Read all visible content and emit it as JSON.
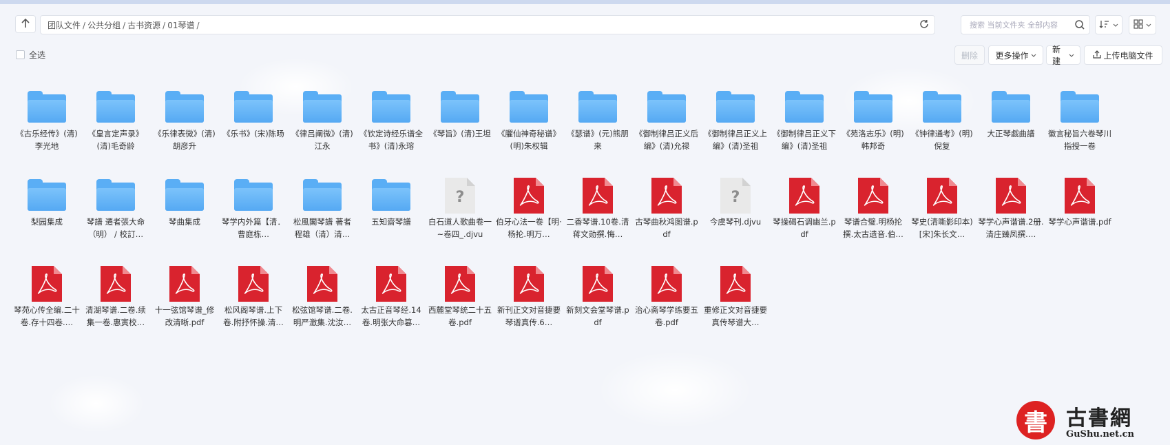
{
  "path": {
    "crumbs": [
      "团队文件",
      "公共分组",
      "古书资源",
      "01琴谱"
    ]
  },
  "search": {
    "placeholder": "搜索 当前文件夹 全部内容"
  },
  "toolbar": {
    "select_all": "全选",
    "delete": "删除",
    "more": "更多操作",
    "new": "新建",
    "upload": "上传电脑文件"
  },
  "colors": {
    "folder": "#5aaef5",
    "pdf": "#d9232e",
    "unknown": "#e9e9e9"
  },
  "files": [
    {
      "type": "folder",
      "name": "《古乐经传》(清)李光地"
    },
    {
      "type": "folder",
      "name": "《皇言定声录》(清)毛奇龄"
    },
    {
      "type": "folder",
      "name": "《乐律表微》(清)胡彦升"
    },
    {
      "type": "folder",
      "name": "《乐书》(宋)陈旸"
    },
    {
      "type": "folder",
      "name": "《律吕阐微》(清)江永"
    },
    {
      "type": "folder",
      "name": "《钦定诗经乐谱全书》(清)永瑢"
    },
    {
      "type": "folder",
      "name": "《琴旨》(清)王坦"
    },
    {
      "type": "folder",
      "name": "《臞仙神奇秘谱》(明)朱权辑"
    },
    {
      "type": "folder",
      "name": "《瑟谱》(元)熊朋来"
    },
    {
      "type": "folder",
      "name": "《御制律吕正义后编》(清)允禄"
    },
    {
      "type": "folder",
      "name": "《御制律吕正义上编》(清)圣祖"
    },
    {
      "type": "folder",
      "name": "《御制律吕正义下编》(清)圣祖"
    },
    {
      "type": "folder",
      "name": "《苑洛志乐》(明)韩邦奇"
    },
    {
      "type": "folder",
      "name": "《钟律通考》(明)倪复"
    },
    {
      "type": "folder",
      "name": "大正琴戯曲譜"
    },
    {
      "type": "folder",
      "name": "徽言秘旨六卷琴川指授一卷"
    },
    {
      "type": "folder",
      "name": "梨园集成"
    },
    {
      "type": "folder",
      "name": "琴譜 遷者張大命（明） / 校訂…"
    },
    {
      "type": "folder",
      "name": "琴曲集成"
    },
    {
      "type": "folder",
      "name": "琴学内外篇【清．曹庭栋…"
    },
    {
      "type": "folder",
      "name": "松風閣琴譜 著者 程雄（清）清…"
    },
    {
      "type": "folder",
      "name": "五知齋琴譜"
    },
    {
      "type": "unknown",
      "name": "白石道人歌曲卷一~卷四_.djvu"
    },
    {
      "type": "pdf",
      "name": "伯牙心法一卷【明·杨抡.明万…"
    },
    {
      "type": "pdf",
      "name": "二香琴谱.10卷.清蒋文勋撰.悔…"
    },
    {
      "type": "pdf",
      "name": "古琴曲秋鸿图谱.pdf"
    },
    {
      "type": "unknown",
      "name": "今虞琴刊.djvu"
    },
    {
      "type": "pdf",
      "name": "琴操碣石调幽兰.pdf"
    },
    {
      "type": "pdf",
      "name": "琴谱合璧.明杨抡撰.太古遗音.伯…"
    },
    {
      "type": "pdf",
      "name": "琴史(清嘶影印本)[宋]朱长文…"
    },
    {
      "type": "pdf",
      "name": "琴学心声谐谱.2册.清庄臻凤撰.…"
    },
    {
      "type": "pdf",
      "name": "琴学心声谐谱.pdf"
    },
    {
      "type": "pdf",
      "name": "琴苑心传全编.二十卷.存十四卷.…"
    },
    {
      "type": "pdf",
      "name": "清湖琴谱.二卷.续集一卷.惠寅校…"
    },
    {
      "type": "pdf",
      "name": "十一弦馆琴谱_修改清晰.pdf"
    },
    {
      "type": "pdf",
      "name": "松风阁琴谱.上下卷.附抒怀操.清…"
    },
    {
      "type": "pdf",
      "name": "松弦馆琴谱.二卷.明严澂集.沈汝…"
    },
    {
      "type": "pdf",
      "name": "太古正音琴经.14卷.明张大命篡…"
    },
    {
      "type": "pdf",
      "name": "西麓堂琴统二十五卷.pdf"
    },
    {
      "type": "pdf",
      "name": "新刊正文对音捷要琴谱真传.6…"
    },
    {
      "type": "pdf",
      "name": "新刻文会堂琴谱.pdf"
    },
    {
      "type": "pdf",
      "name": "治心斋琴学练要五卷.pdf"
    },
    {
      "type": "pdf",
      "name": "重修正文对音捷要真传琴谱大…"
    }
  ],
  "logo": {
    "seal_char": "書",
    "name": "古書網",
    "url": "GuShu.net.cn"
  }
}
